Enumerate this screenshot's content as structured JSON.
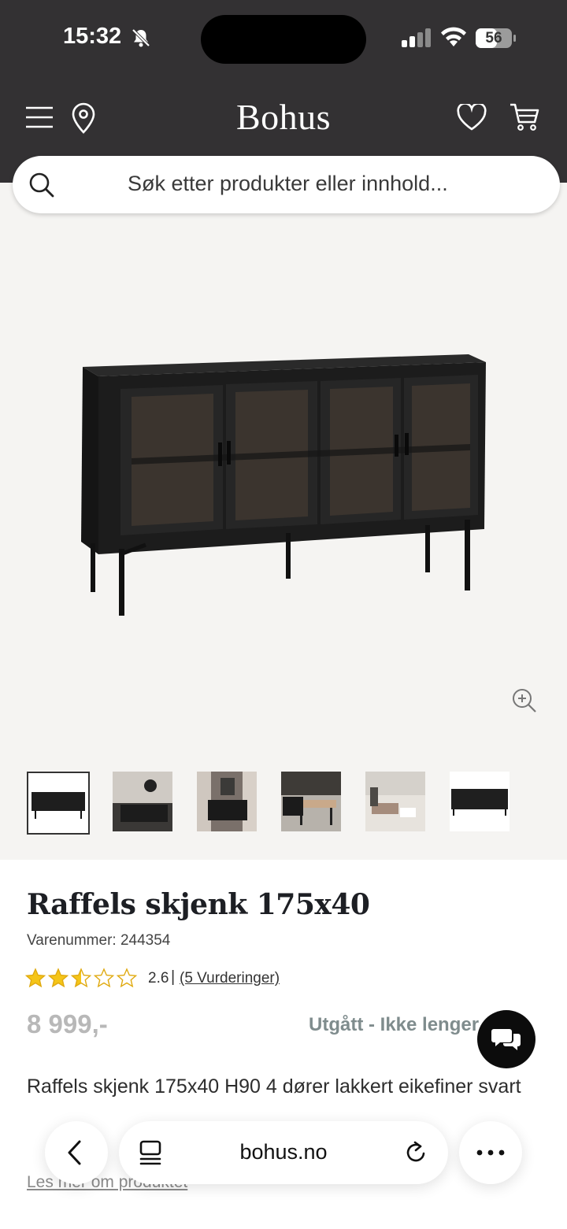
{
  "status_bar": {
    "time": "15:32",
    "battery": "56"
  },
  "header": {
    "logo": "Bohus"
  },
  "search": {
    "placeholder": "Søk etter produkter eller innhold..."
  },
  "product": {
    "title": "Raffels skjenk 175x40",
    "sku": "Varenummer: 244354",
    "rating_value": "2.6",
    "rating_stars": 2.5,
    "reviews_link": "(5 Vurderinger)",
    "price": "8 999,-",
    "availability": "Utgått - Ikke lenger salg",
    "description": "Raffels skjenk 175x40 H90 4 dører lakkert eikefiner svart",
    "read_more": "Les mer om produktet"
  },
  "browser": {
    "url": "bohus.no"
  },
  "colors": {
    "header_bg": "#333133",
    "star": "#f5c518",
    "price_grey": "#b8b8b8",
    "status_grey": "#7f8c8d"
  }
}
